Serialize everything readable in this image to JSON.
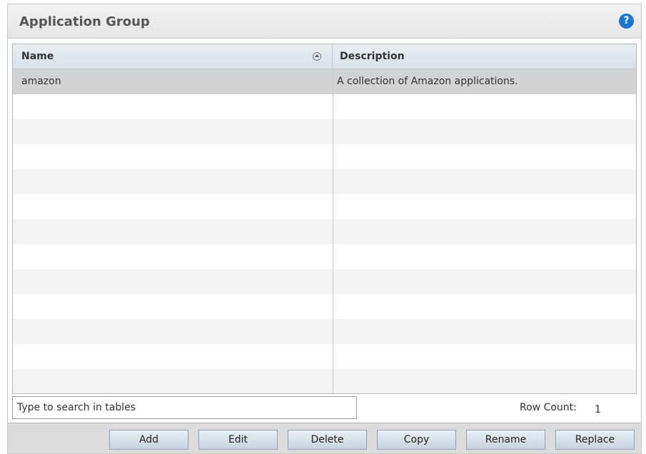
{
  "panel": {
    "title": "Application Group",
    "help_glyph": "?"
  },
  "table": {
    "columns": [
      "Name",
      "Description"
    ],
    "rows": [
      {
        "name": "amazon",
        "description": "A collection of Amazon applications."
      }
    ]
  },
  "search": {
    "placeholder": "Type to search in tables"
  },
  "row_count": {
    "label": "Row Count:",
    "value": "1"
  },
  "buttons": {
    "add": "Add",
    "edit": "Edit",
    "delete": "Delete",
    "copy": "Copy",
    "rename": "Rename",
    "replace": "Replace"
  },
  "icons": {
    "help": "help-icon",
    "sort": "sort-ascending-icon"
  },
  "colors": {
    "help_icon": "#1976d2",
    "selected_row": "#d3d3d3",
    "header_bg": "#e6e6e6"
  }
}
